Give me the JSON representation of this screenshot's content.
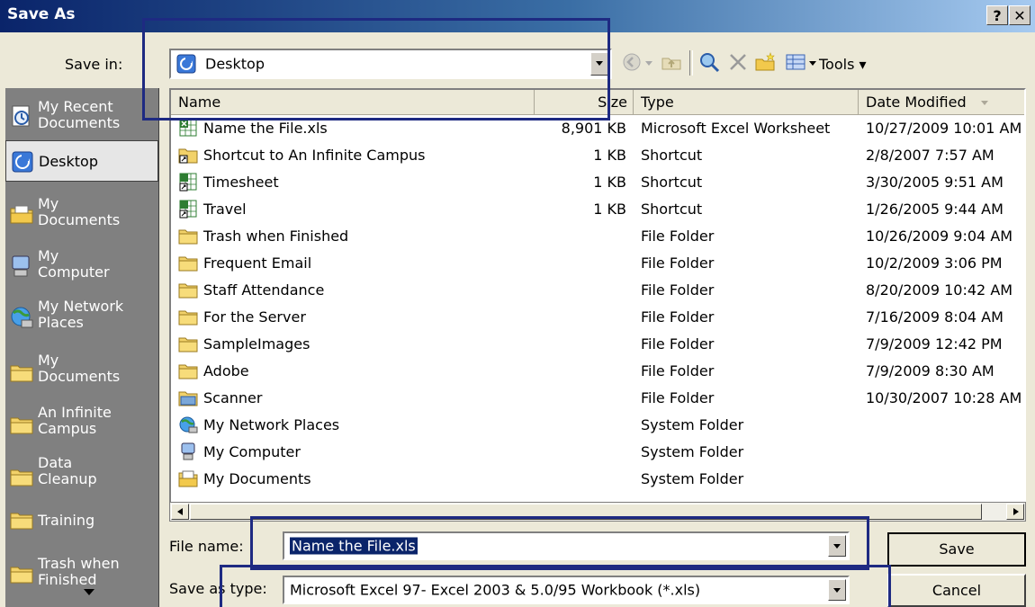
{
  "window": {
    "title": "Save As",
    "help_glyph": "?",
    "close_glyph": "✕"
  },
  "save_in": {
    "label": "Save in:",
    "value": "Desktop"
  },
  "toolbar": {
    "tools_label": "Tools"
  },
  "places": [
    {
      "label": "My Recent\nDocuments",
      "icon": "recent-documents-icon"
    },
    {
      "label": "Desktop",
      "icon": "desktop-icon",
      "selected": true
    },
    {
      "label": "My\nDocuments",
      "icon": "my-documents-icon"
    },
    {
      "label": "My\nComputer",
      "icon": "my-computer-icon"
    },
    {
      "label": "My Network\nPlaces",
      "icon": "network-places-icon"
    },
    {
      "label": "My\nDocuments",
      "icon": "folder-icon"
    },
    {
      "label": "An Infinite\nCampus",
      "icon": "folder-icon"
    },
    {
      "label": "Data\nCleanup",
      "icon": "folder-icon"
    },
    {
      "label": "Training",
      "icon": "folder-icon"
    },
    {
      "label": "Trash when\nFinished",
      "icon": "folder-icon"
    }
  ],
  "columns": {
    "name": "Name",
    "size": "Size",
    "type": "Type",
    "date": "Date Modified"
  },
  "files": [
    {
      "name": "Name the File.xls",
      "size": "8,901 KB",
      "type": "Microsoft Excel Worksheet",
      "date": "10/27/2009 10:01 AM",
      "icon": "excel-icon"
    },
    {
      "name": "Shortcut to An Infinite Campus",
      "size": "1 KB",
      "type": "Shortcut",
      "date": "2/8/2007 7:57 AM",
      "icon": "folder-shortcut-icon"
    },
    {
      "name": "Timesheet",
      "size": "1 KB",
      "type": "Shortcut",
      "date": "3/30/2005 9:51 AM",
      "icon": "excel-shortcut-icon"
    },
    {
      "name": "Travel",
      "size": "1 KB",
      "type": "Shortcut",
      "date": "1/26/2005 9:44 AM",
      "icon": "excel-shortcut-icon"
    },
    {
      "name": "Trash when Finished",
      "size": "",
      "type": "File Folder",
      "date": "10/26/2009 9:04 AM",
      "icon": "folder-icon"
    },
    {
      "name": "Frequent Email",
      "size": "",
      "type": "File Folder",
      "date": "10/2/2009 3:06 PM",
      "icon": "folder-icon"
    },
    {
      "name": "Staff Attendance",
      "size": "",
      "type": "File Folder",
      "date": "8/20/2009 10:42 AM",
      "icon": "folder-icon"
    },
    {
      "name": "For the Server",
      "size": "",
      "type": "File Folder",
      "date": "7/16/2009 8:04 AM",
      "icon": "folder-icon"
    },
    {
      "name": "SampleImages",
      "size": "",
      "type": "File Folder",
      "date": "7/9/2009 12:42 PM",
      "icon": "folder-icon"
    },
    {
      "name": "Adobe",
      "size": "",
      "type": "File Folder",
      "date": "7/9/2009 8:30 AM",
      "icon": "folder-icon"
    },
    {
      "name": "Scanner",
      "size": "",
      "type": "File Folder",
      "date": "10/30/2007 10:28 AM",
      "icon": "scanner-folder-icon"
    },
    {
      "name": "My Network Places",
      "size": "",
      "type": "System Folder",
      "date": "",
      "icon": "network-places-icon"
    },
    {
      "name": "My Computer",
      "size": "",
      "type": "System Folder",
      "date": "",
      "icon": "my-computer-icon"
    },
    {
      "name": "My Documents",
      "size": "",
      "type": "System Folder",
      "date": "",
      "icon": "my-documents-icon"
    }
  ],
  "file_name": {
    "label": "File name:",
    "value": "Name the File.xls"
  },
  "save_as_type": {
    "label": "Save as type:",
    "value": "Microsoft Excel 97- Excel 2003 & 5.0/95 Workbook (*.xls)"
  },
  "buttons": {
    "save": "Save",
    "cancel": "Cancel"
  },
  "colors": {
    "annotation": "#1e2a82",
    "title_start": "#0a246a",
    "title_end": "#a6caf0",
    "selection": "#0a246a"
  }
}
